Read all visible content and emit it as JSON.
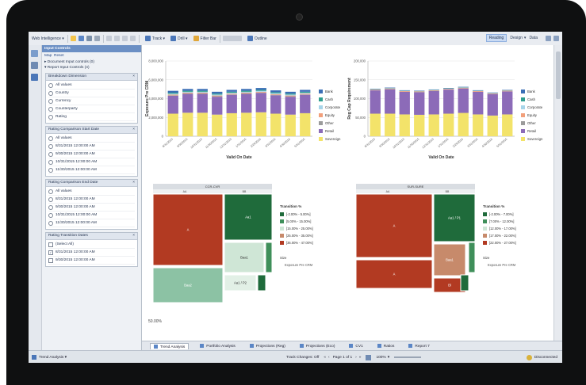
{
  "toolbar": {
    "app_menu": "Web Intelligence",
    "track": "Track",
    "drill": "Drill",
    "filter_bar": "Filter Bar",
    "outline": "Outline",
    "reading": "Reading",
    "design": "Design",
    "data": "Data"
  },
  "input_panel": {
    "title": "Input Controls",
    "map_label": "Map",
    "reset_label": "Reset",
    "tree": [
      "Document Input controls (0)",
      "Report Input Controls (4)"
    ],
    "controls": [
      {
        "title": "Breakdown Dimension",
        "type": "radio",
        "options": [
          "All values",
          "Country",
          "Currency",
          "Counterparty",
          "Rating"
        ]
      },
      {
        "title": "Rating Comparison Start Date",
        "type": "radio",
        "options": [
          "All values",
          "8/31/2015 12:00:00 AM",
          "9/30/2015 12:00:00 AM",
          "10/31/2015 12:00:00 AM",
          "11/30/2015 12:00:00 AM"
        ]
      },
      {
        "title": "Rating Comparison End Date",
        "type": "radio",
        "options": [
          "All values",
          "8/31/2015 12:00:00 AM",
          "9/30/2015 12:00:00 AM",
          "10/31/2015 12:00:00 AM",
          "11/30/2015 12:00:00 AM"
        ]
      },
      {
        "title": "Rating Transition Dates",
        "type": "check",
        "options": [
          "(Select All)",
          "8/31/2015 12:00:00 AM",
          "9/30/2015 12:00:00 AM"
        ]
      }
    ]
  },
  "chart_data": [
    {
      "type": "bar",
      "stacked": true,
      "ylabel": "Exposure Pre CRM",
      "xlabel": "Valid On Date",
      "ylim": [
        0,
        8000000
      ],
      "yticks": [
        "0",
        "2,000,000",
        "4,000,000",
        "6,000,000",
        "8,000,000"
      ],
      "categories": [
        "8/31/2015",
        "9/30/2015",
        "10/31/2015",
        "11/30/2015",
        "12/31/2015",
        "1/31/2016",
        "2/29/2016",
        "3/31/2016",
        "4/30/2016",
        "5/31/2016"
      ],
      "series": [
        {
          "name": "Bank",
          "color": "#3b6fb6",
          "values": [
            200000,
            200000,
            200000,
            200000,
            200000,
            200000,
            200000,
            200000,
            200000,
            200000
          ]
        },
        {
          "name": "Cash",
          "color": "#2f9e8f",
          "values": [
            100000,
            100000,
            100000,
            100000,
            100000,
            100000,
            100000,
            100000,
            100000,
            100000
          ]
        },
        {
          "name": "Corporate",
          "color": "#a7d5e9",
          "values": [
            100000,
            100000,
            100000,
            100000,
            100000,
            100000,
            100000,
            100000,
            100000,
            100000
          ]
        },
        {
          "name": "Equity",
          "color": "#f2a07b",
          "values": [
            80000,
            80000,
            80000,
            80000,
            80000,
            80000,
            80000,
            80000,
            80000,
            80000
          ]
        },
        {
          "name": "Other",
          "color": "#9b9b9b",
          "values": [
            50000,
            50000,
            50000,
            50000,
            50000,
            50000,
            50000,
            50000,
            50000,
            50000
          ]
        },
        {
          "name": "Retail",
          "color": "#8c6bb8",
          "values": [
            1900000,
            2000000,
            2000000,
            1900000,
            1950000,
            2000000,
            2050000,
            1950000,
            1900000,
            1950000
          ]
        },
        {
          "name": "Sovereign",
          "color": "#f3e36a",
          "values": [
            2400000,
            2500000,
            2500000,
            2300000,
            2450000,
            2500000,
            2550000,
            2400000,
            2300000,
            2450000
          ]
        }
      ]
    },
    {
      "type": "bar",
      "stacked": true,
      "ylabel": "Reg Cap Requirement",
      "xlabel": "Valid On Date",
      "ylim": [
        0,
        200000
      ],
      "yticks": [
        "0",
        "50,000",
        "100,000",
        "150,000",
        "200,000"
      ],
      "categories": [
        "8/31/2015",
        "9/30/2015",
        "10/31/2015",
        "11/30/2015",
        "12/31/2015",
        "1/31/2016",
        "2/29/2016",
        "3/31/2016",
        "4/30/2016",
        "5/31/2016"
      ],
      "series": [
        {
          "name": "Bank",
          "color": "#3b6fb6",
          "values": [
            1000,
            1000,
            1000,
            1000,
            1000,
            1000,
            1000,
            1000,
            1000,
            1000
          ]
        },
        {
          "name": "Cash",
          "color": "#2f9e8f",
          "values": [
            500,
            500,
            500,
            500,
            500,
            500,
            500,
            500,
            500,
            500
          ]
        },
        {
          "name": "Corporate",
          "color": "#a7d5e9",
          "values": [
            800,
            800,
            800,
            800,
            800,
            800,
            800,
            800,
            800,
            800
          ]
        },
        {
          "name": "Equity",
          "color": "#f2a07b",
          "values": [
            1500,
            1500,
            1500,
            1500,
            1500,
            1500,
            1500,
            1500,
            1500,
            1500
          ]
        },
        {
          "name": "Other",
          "color": "#9b9b9b",
          "values": [
            500,
            500,
            500,
            500,
            500,
            500,
            500,
            500,
            500,
            500
          ]
        },
        {
          "name": "Retail",
          "color": "#8c6bb8",
          "values": [
            62000,
            65000,
            60000,
            60000,
            62000,
            64000,
            65000,
            60000,
            57000,
            61000
          ]
        },
        {
          "name": "Sovereign",
          "color": "#f3e36a",
          "values": [
            60000,
            60000,
            58000,
            57000,
            58000,
            60000,
            62000,
            58000,
            55000,
            58000
          ]
        }
      ]
    }
  ],
  "treemap_left": {
    "header": "CCR-CVR",
    "legend_title": "Transition %",
    "legend": [
      {
        "label": "[-2.00% - 5.00%]",
        "color": "#1f6b3b"
      },
      {
        "label": "[5.00% - 15.00%]",
        "color": "#3f8f5a"
      },
      {
        "label": "[15.00% - 25.00%]",
        "color": "#cfe6d6"
      },
      {
        "label": "[25.00% - 35.00%]",
        "color": "#c78a6b"
      },
      {
        "label": "[35.00% - 47.00%]",
        "color": "#b23a22"
      }
    ],
    "size_label": "Size",
    "size_value": "Exposure Pre CRM",
    "blocks": [
      {
        "label": "A",
        "color": "#b23a22"
      },
      {
        "label": "Aa1",
        "color": "#1f6b3b"
      },
      {
        "label": "Baa1",
        "color": "#cfe6d6"
      },
      {
        "label": "Baa2",
        "color": "#8cc2a4"
      },
      {
        "label": "Aa1 / P2",
        "color": "#e2f0e6"
      }
    ],
    "top_labels": [
      "AA",
      "BB"
    ]
  },
  "treemap_right": {
    "header": "SUR-SURE",
    "legend_title": "Transition %",
    "legend": [
      {
        "label": "[-2.00% - 7.00%]",
        "color": "#1f6b3b"
      },
      {
        "label": "[7.00% - 12.00%]",
        "color": "#3f8f5a"
      },
      {
        "label": "[12.00% - 17.00%]",
        "color": "#cfe6d6"
      },
      {
        "label": "[17.00% - 22.00%]",
        "color": "#c78a6b"
      },
      {
        "label": "[22.00% - 27.00%]",
        "color": "#b23a22"
      }
    ],
    "size_label": "Size",
    "size_value": "Exposure Pre CRM",
    "blocks": [
      {
        "label": "A",
        "color": "#b23a22"
      },
      {
        "label": "Aa1 / P1",
        "color": "#1f6b3b"
      },
      {
        "label": "Baa1",
        "color": "#c78a6b"
      },
      {
        "label": "Bl",
        "color": "#b23a22"
      }
    ],
    "top_labels": [
      "AA",
      "BB"
    ]
  },
  "main_footer": {
    "zoom_corner": "50.00%"
  },
  "tabs": [
    "Trend Analysis",
    "Portfolio Analysis",
    "Projections (Reg)",
    "Projections (Eco)",
    "CV1",
    "Ratios",
    "Report 7"
  ],
  "active_tab": "Trend Analysis",
  "status": {
    "report_name": "Trend Analysis",
    "track_changes": "Track Changes: Off",
    "page": "Page 1 of 1",
    "zoom": "100%",
    "connection": "Disconnected"
  }
}
